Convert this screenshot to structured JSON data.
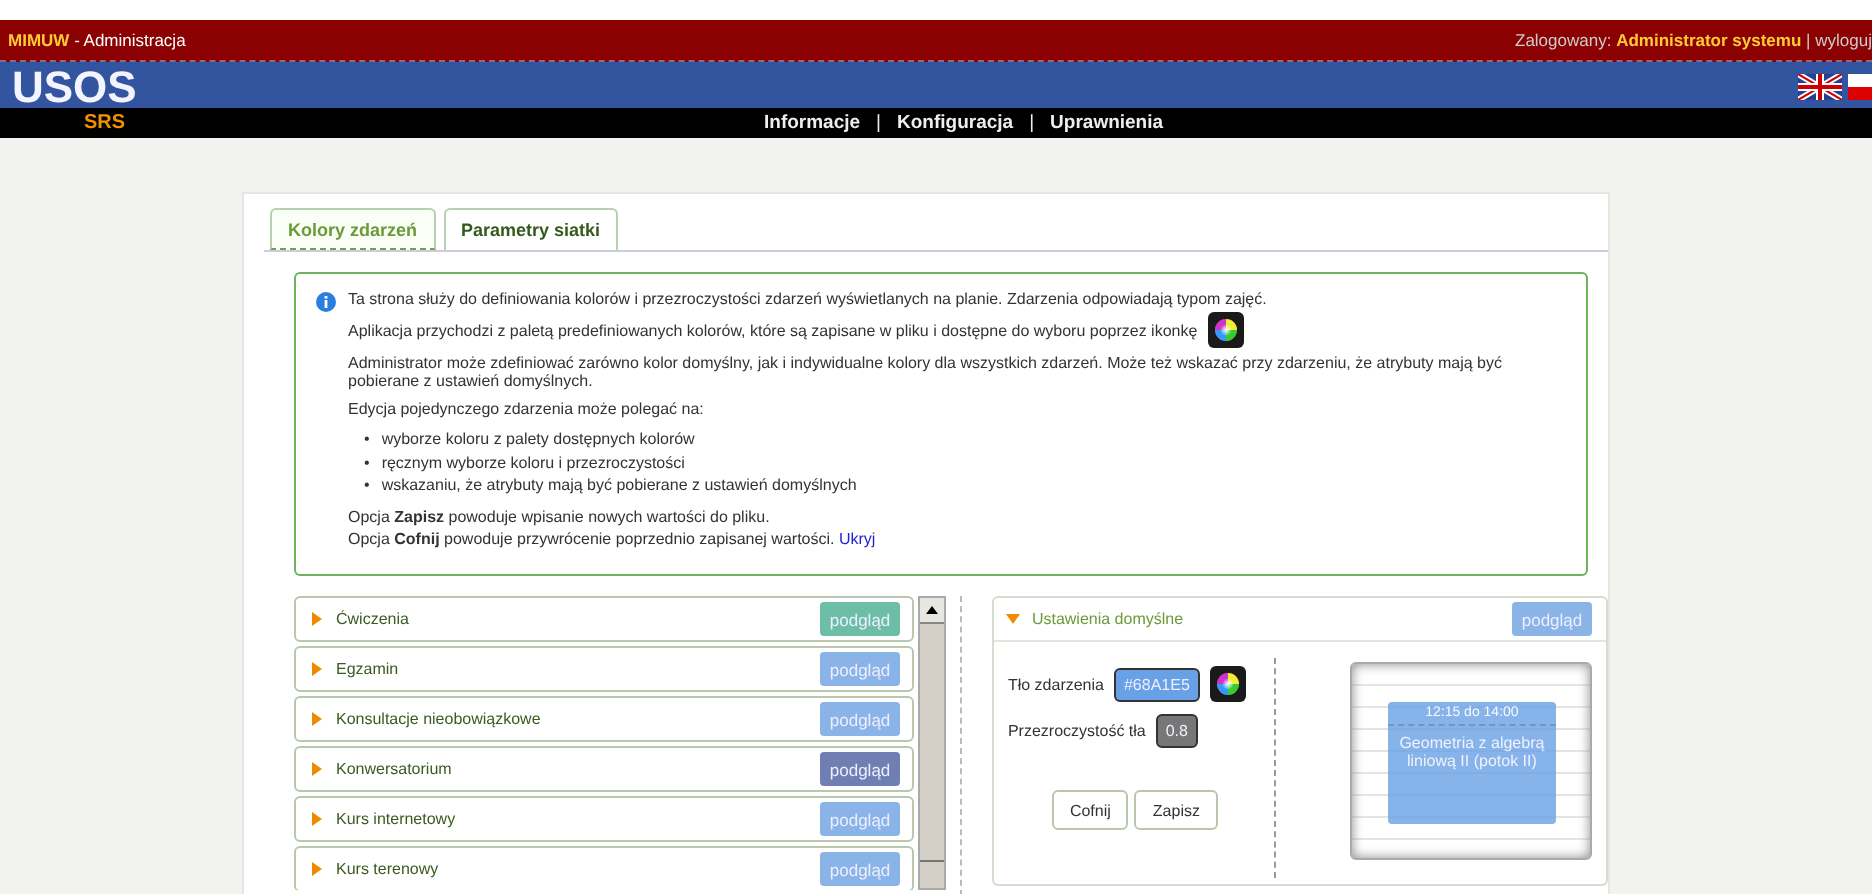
{
  "header": {
    "app": "MIMUW",
    "app_suffix": "- Administracja",
    "logged_label": "Zalogowany:",
    "user": "Administrator systemu",
    "separator": "|",
    "logout": "wyloguj"
  },
  "logo": {
    "title": "USOS",
    "subtitle": "SRS"
  },
  "nav": [
    {
      "kind": "link",
      "label": "Informacje"
    },
    {
      "kind": "separator",
      "label": "|"
    },
    {
      "kind": "link",
      "label": "Konfiguracja"
    },
    {
      "kind": "separator",
      "label": "|"
    },
    {
      "kind": "link",
      "label": "Uprawnienia"
    }
  ],
  "tabs": [
    {
      "label": "Kolory zdarzeń",
      "selected": true
    },
    {
      "label": "Parametry siatki",
      "selected": false
    }
  ],
  "info": {
    "blocks": [
      {
        "kind": "para",
        "text": "Ta strona służy do definiowania kolorów i przezroczystości zdarzeń wyświetlanych na planie. Zdarzenia odpowiadają typom zajęć."
      },
      {
        "kind": "para_icon",
        "text": "Aplikacja przychodzi z paletą predefiniowanych kolorów, które są zapisane w pliku i dostępne do wyboru poprzez ikonkę"
      },
      {
        "kind": "para",
        "text": "Administrator może zdefiniować zarówno kolor domyślny, jak i indywidualne kolory dla wszystkich zdarzeń. Może też wskazać przy zdarzeniu, że atrybuty mają być pobierane z ustawień domyślnych."
      },
      {
        "kind": "para",
        "text": "Edycja pojedynczego zdarzenia może polegać na:"
      },
      {
        "kind": "list",
        "items": [
          {
            "bullet": "•",
            "text": "wyborze koloru z palety dostępnych kolorów"
          },
          {
            "bullet": "•",
            "text": "ręcznym wyborze koloru i przezroczystości"
          },
          {
            "bullet": "•",
            "text": "wskazaniu, że atrybuty mają być pobierane z ustawień domyślnych"
          }
        ]
      },
      {
        "kind": "line",
        "text": "Opcja **Zapisz** powoduje wpisanie nowych wartości do pliku."
      },
      {
        "kind": "line_link",
        "text": "Opcja **Cofnij** powoduje przywrócenie poprzednio zapisanej wartości.",
        "link": "Ukryj"
      }
    ]
  },
  "events": [
    {
      "name": "Ćwiczenia",
      "expanded": false,
      "color": "#6cbfa6",
      "button": "podgląd"
    },
    {
      "name": "Egzamin",
      "expanded": false,
      "color": "#8ab4e8",
      "button": "podgląd"
    },
    {
      "name": "Konsultacje nieobowiązkowe",
      "expanded": false,
      "color": "#8ab4e8",
      "button": "podgląd"
    },
    {
      "name": "Konwersatorium",
      "expanded": false,
      "color": "#6f7fb3",
      "button": "podgląd"
    },
    {
      "name": "Kurs internetowy",
      "expanded": false,
      "color": "#8ab4e8",
      "button": "podgląd"
    },
    {
      "name": "Kurs terenowy",
      "expanded": false,
      "color": "#8ab4e8",
      "button": "podgląd"
    }
  ],
  "defaults": {
    "title": "Ustawienia domyślne",
    "expanded": true,
    "button": "podgląd",
    "background_label": "Tło zdarzenia",
    "background_value": "#68A1E5",
    "opacity_label": "Przezroczystość tła",
    "opacity_value": "0.8",
    "buttons": [
      "Cofnij",
      "Zapisz"
    ],
    "preview": {
      "time": "12:15 do 14:00",
      "title": "Geometria z algebrą liniową II (potok II)"
    }
  }
}
